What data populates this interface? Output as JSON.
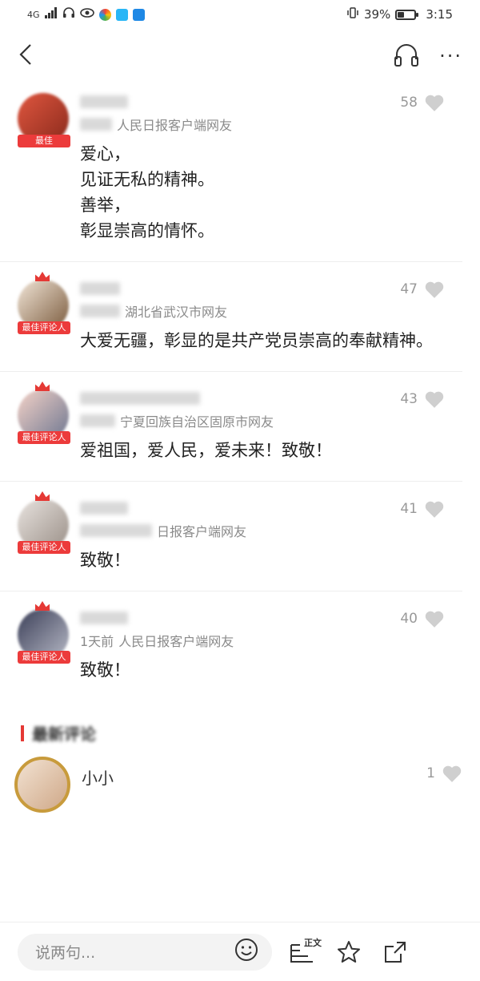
{
  "statusbar": {
    "network": "4G",
    "battery": "39%",
    "battery_level": 0.39,
    "time": "3:15"
  },
  "nav": {
    "back_icon": "chevron-left-icon",
    "listen_icon": "headphones-icon",
    "more_icon": "more-dots-icon",
    "more_label": "···"
  },
  "comments": [
    {
      "badge": "最佳",
      "meta": "人民日报客户端网友",
      "likes": "58",
      "text": "爱心，\n见证无私的精神。\n善举，\n彰显崇高的情怀。"
    },
    {
      "badge": "最佳评论人",
      "meta": "湖北省武汉市网友",
      "likes": "47",
      "text": "大爱无疆，彰显的是共产党员崇高的奉献精神。"
    },
    {
      "badge": "最佳评论人",
      "meta": "宁夏回族自治区固原市网友",
      "likes": "43",
      "text": "爱祖国，爱人民，爱未来！致敬！"
    },
    {
      "badge": "最佳评论人",
      "meta": "日报客户端网友",
      "likes": "41",
      "text": "致敬！"
    },
    {
      "badge": "最佳评论人",
      "time": "1天前",
      "meta": "人民日报客户端网友",
      "likes": "40",
      "text": "致敬！"
    }
  ],
  "section": {
    "title": "最新评论"
  },
  "latest": {
    "name": "小小",
    "likes": "1"
  },
  "bottombar": {
    "placeholder": "说两句...",
    "article_label": "正文"
  },
  "colors": {
    "accent": "#e53935",
    "badge": "#ec3b3b",
    "gold": "#c89b3c"
  }
}
